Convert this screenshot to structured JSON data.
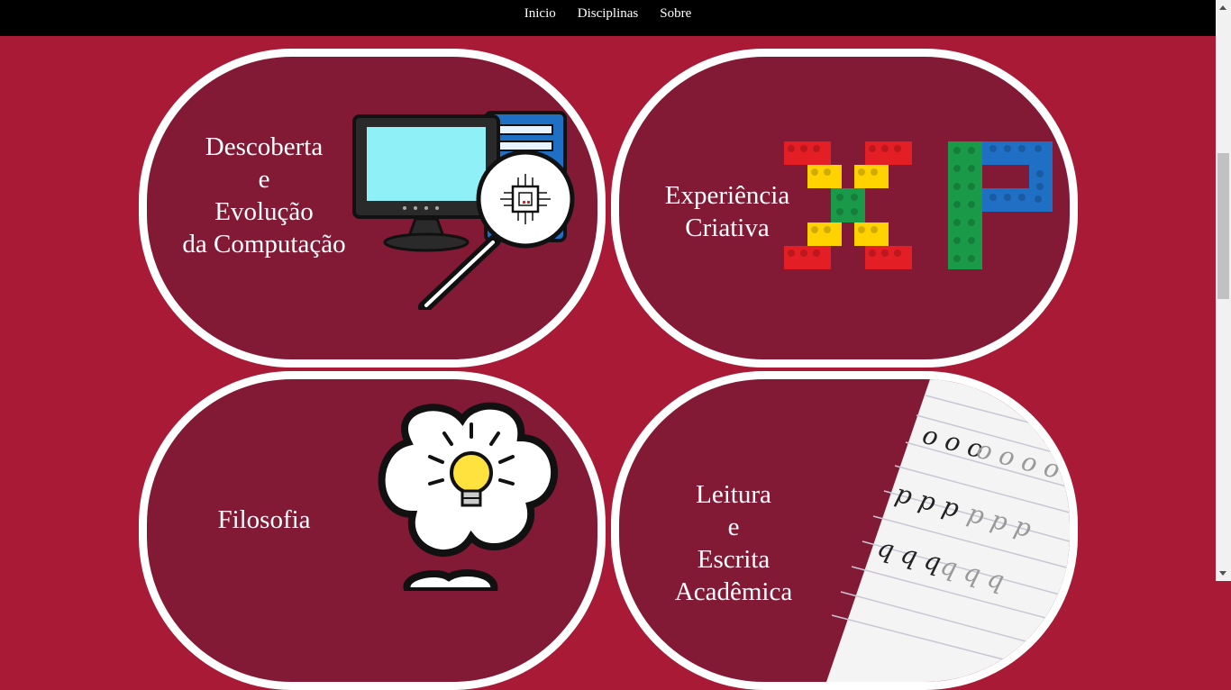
{
  "nav": {
    "items": [
      "Inicio",
      "Disciplinas",
      "Sobre"
    ]
  },
  "cards": [
    {
      "title": "Descoberta\ne\nEvolução\nda Computação",
      "icon": "computer-magnifier-icon"
    },
    {
      "title": "Experiência\nCriativa",
      "icon": "lego-xp-icon"
    },
    {
      "title": "Filosofia",
      "icon": "lightbulb-cloud-icon"
    },
    {
      "title": "Leitura\ne\nEscrita\nAcadêmica",
      "icon": "handwriting-paper-icon"
    }
  ],
  "lego_letters": "XP",
  "handwriting_rows": [
    "o o o",
    "p p p",
    "q q q"
  ],
  "colors": {
    "page_background": "#a81a35",
    "card_background": "#831a35",
    "card_border": "#ffffff",
    "nav_background": "#000000",
    "lego_red": "#e31e24",
    "lego_yellow": "#ffd200",
    "lego_green": "#1a9a48",
    "lego_blue": "#1f6fc4"
  }
}
